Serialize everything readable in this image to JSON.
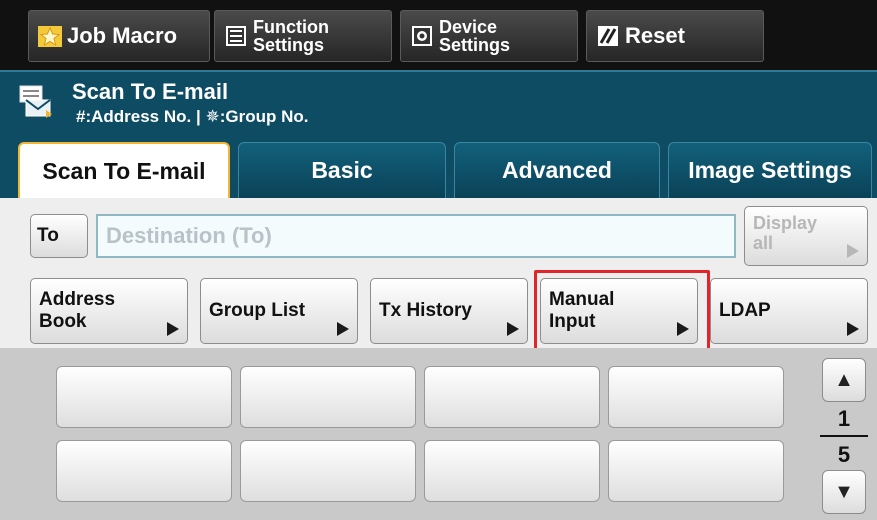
{
  "toolbar": {
    "job_macro": "Job Macro",
    "function_settings_line1": "Function",
    "function_settings_line2": "Settings",
    "device_settings_line1": "Device",
    "device_settings_line2": "Settings",
    "reset": "Reset"
  },
  "header": {
    "title": "Scan To E-mail",
    "subtitle": "#:Address No. | ✵:Group No."
  },
  "tabs": [
    {
      "label": "Scan To E-mail",
      "active": true
    },
    {
      "label": "Basic",
      "active": false
    },
    {
      "label": "Advanced",
      "active": false
    },
    {
      "label": "Image Settings",
      "active": false
    }
  ],
  "destination": {
    "to_label": "To",
    "placeholder": "Destination (To)",
    "display_all_line1": "Display",
    "display_all_line2": "all"
  },
  "select_buttons": {
    "address_book_line1": "Address",
    "address_book_line2": "Book",
    "group_list": "Group List",
    "tx_history": "Tx History",
    "manual_input_line1": "Manual",
    "manual_input_line2": "Input",
    "ldap": "LDAP"
  },
  "pager": {
    "current": "1",
    "total": "5"
  },
  "colors": {
    "header_bg": "#0d4c62",
    "active_tab_border": "#f2b431",
    "highlight": "#e0252b"
  }
}
